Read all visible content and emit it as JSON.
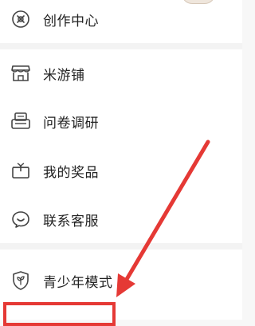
{
  "menu": {
    "items": [
      {
        "label": "创作中心",
        "icon": "creation-center-icon"
      },
      {
        "label": "米游铺",
        "icon": "shop-icon"
      },
      {
        "label": "问卷调研",
        "icon": "survey-icon"
      },
      {
        "label": "我的奖品",
        "icon": "gift-icon"
      },
      {
        "label": "联系客服",
        "icon": "customer-service-icon"
      },
      {
        "label": "青少年模式",
        "icon": "youth-mode-shield-icon"
      }
    ]
  },
  "annotation": {
    "arrow_color": "#e53935",
    "box_color": "#e53935"
  }
}
